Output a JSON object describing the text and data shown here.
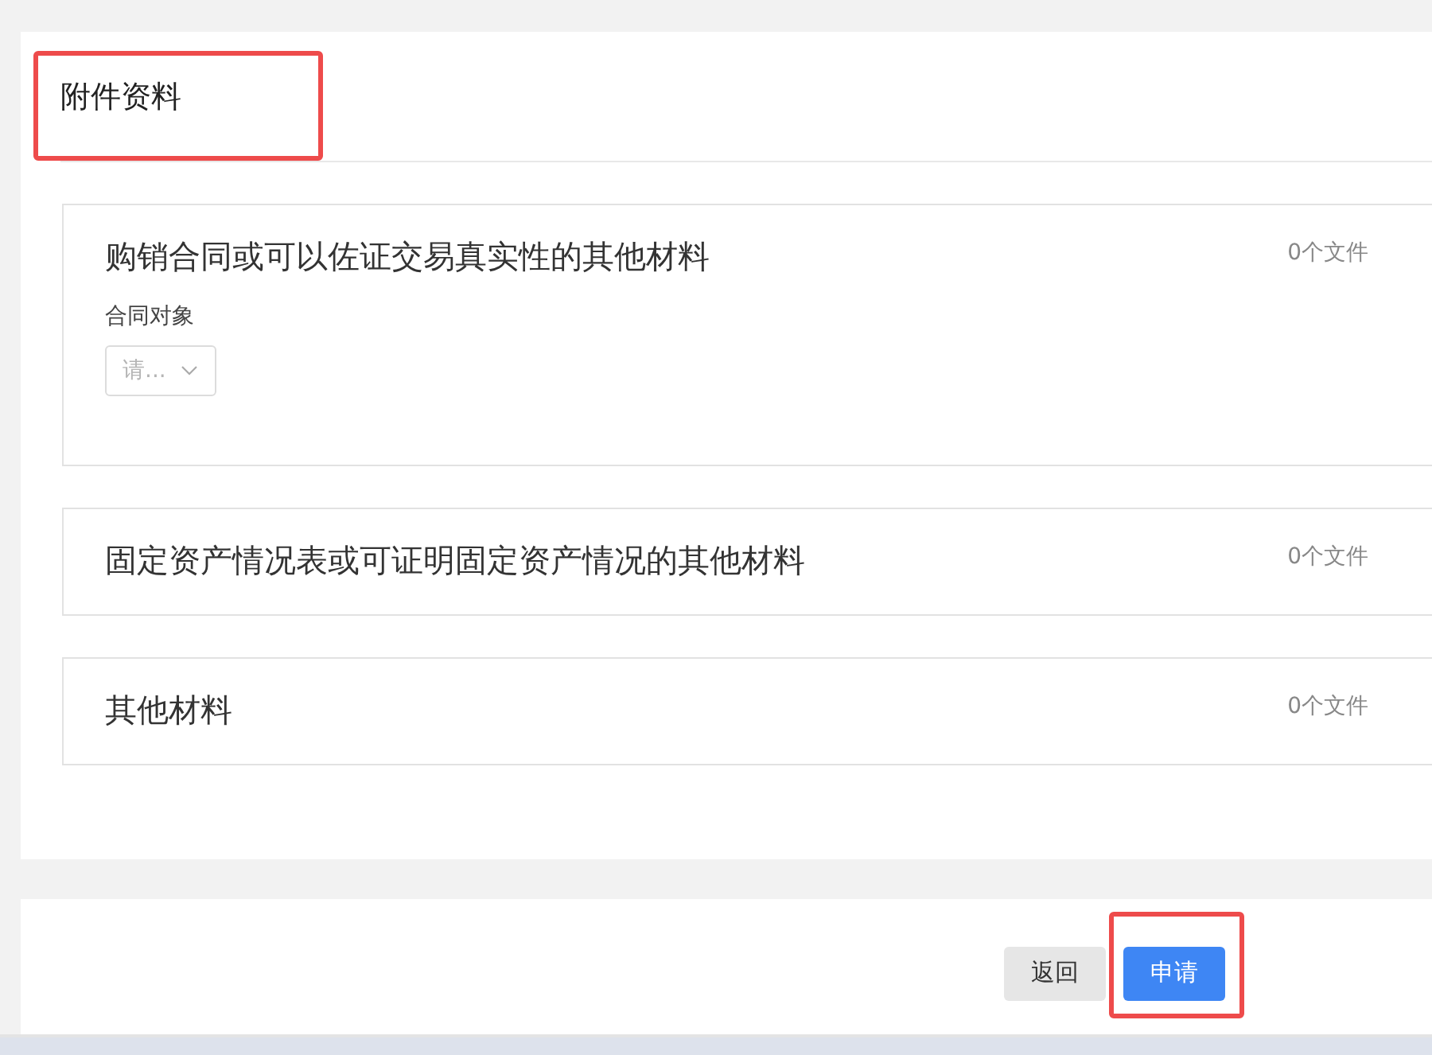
{
  "section": {
    "title": "附件资料",
    "highlighted": true
  },
  "attachments": [
    {
      "title": "购销合同或可以佐证交易真实性的其他材料",
      "file_count": "0个文件",
      "fields": [
        {
          "kind": "select",
          "label": "合同对象",
          "placeholder": "请..."
        }
      ]
    },
    {
      "title": "固定资产情况表或可证明固定资产情况的其他材料",
      "file_count": "0个文件"
    },
    {
      "title": "其他材料",
      "file_count": "0个文件"
    }
  ],
  "buttons": [
    {
      "label": "返回",
      "kind": "secondary",
      "highlighted": false
    },
    {
      "label": "申请",
      "kind": "primary",
      "highlighted": true
    }
  ]
}
